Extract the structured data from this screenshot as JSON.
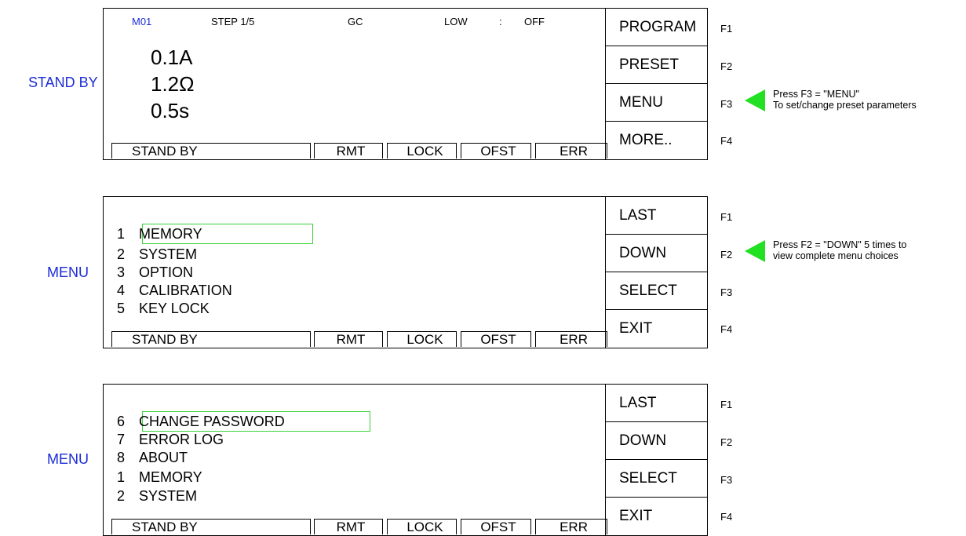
{
  "colors": {
    "accent": "#1a2bd6",
    "highlight": "#3cd23c",
    "arrow": "#22e022"
  },
  "status_bar": {
    "stand_by": "STAND BY",
    "rmt": "RMT",
    "lock": "LOCK",
    "ofst": "OFST",
    "err": "ERR"
  },
  "fkeys": [
    "F1",
    "F2",
    "F3",
    "F4"
  ],
  "panel1": {
    "side_label": "STAND BY",
    "header": {
      "memory": "M01",
      "step": "STEP 1/5",
      "gc": "GC",
      "low": "LOW",
      "colon": ":",
      "off": "OFF"
    },
    "values": [
      "0.1A",
      "1.2Ω",
      "0.5s"
    ],
    "softkeys": [
      "PROGRAM",
      "PRESET",
      "MENU",
      "MORE.."
    ],
    "note": {
      "line1": "Press F3 = \"MENU\"",
      "line2": "To set/change preset parameters",
      "icon": "arrow-left-icon"
    }
  },
  "panel2": {
    "side_label": "MENU",
    "items": [
      {
        "num": "1",
        "label": "MEMORY"
      },
      {
        "num": "2",
        "label": "SYSTEM"
      },
      {
        "num": "3",
        "label": "OPTION"
      },
      {
        "num": "4",
        "label": "CALIBRATION"
      },
      {
        "num": "5",
        "label": "KEY LOCK"
      }
    ],
    "softkeys": [
      "LAST",
      "DOWN",
      "SELECT",
      "EXIT"
    ],
    "note": {
      "line1": "Press F2 = \"DOWN\" 5 times to",
      "line2": "view complete menu choices",
      "icon": "arrow-left-icon"
    }
  },
  "panel3": {
    "side_label": "MENU",
    "items": [
      {
        "num": "6",
        "label": "CHANGE PASSWORD"
      },
      {
        "num": "7",
        "label": "ERROR LOG"
      },
      {
        "num": "8",
        "label": "ABOUT"
      },
      {
        "num": "1",
        "label": "MEMORY"
      },
      {
        "num": "2",
        "label": "SYSTEM"
      }
    ],
    "softkeys": [
      "LAST",
      "DOWN",
      "SELECT",
      "EXIT"
    ]
  }
}
